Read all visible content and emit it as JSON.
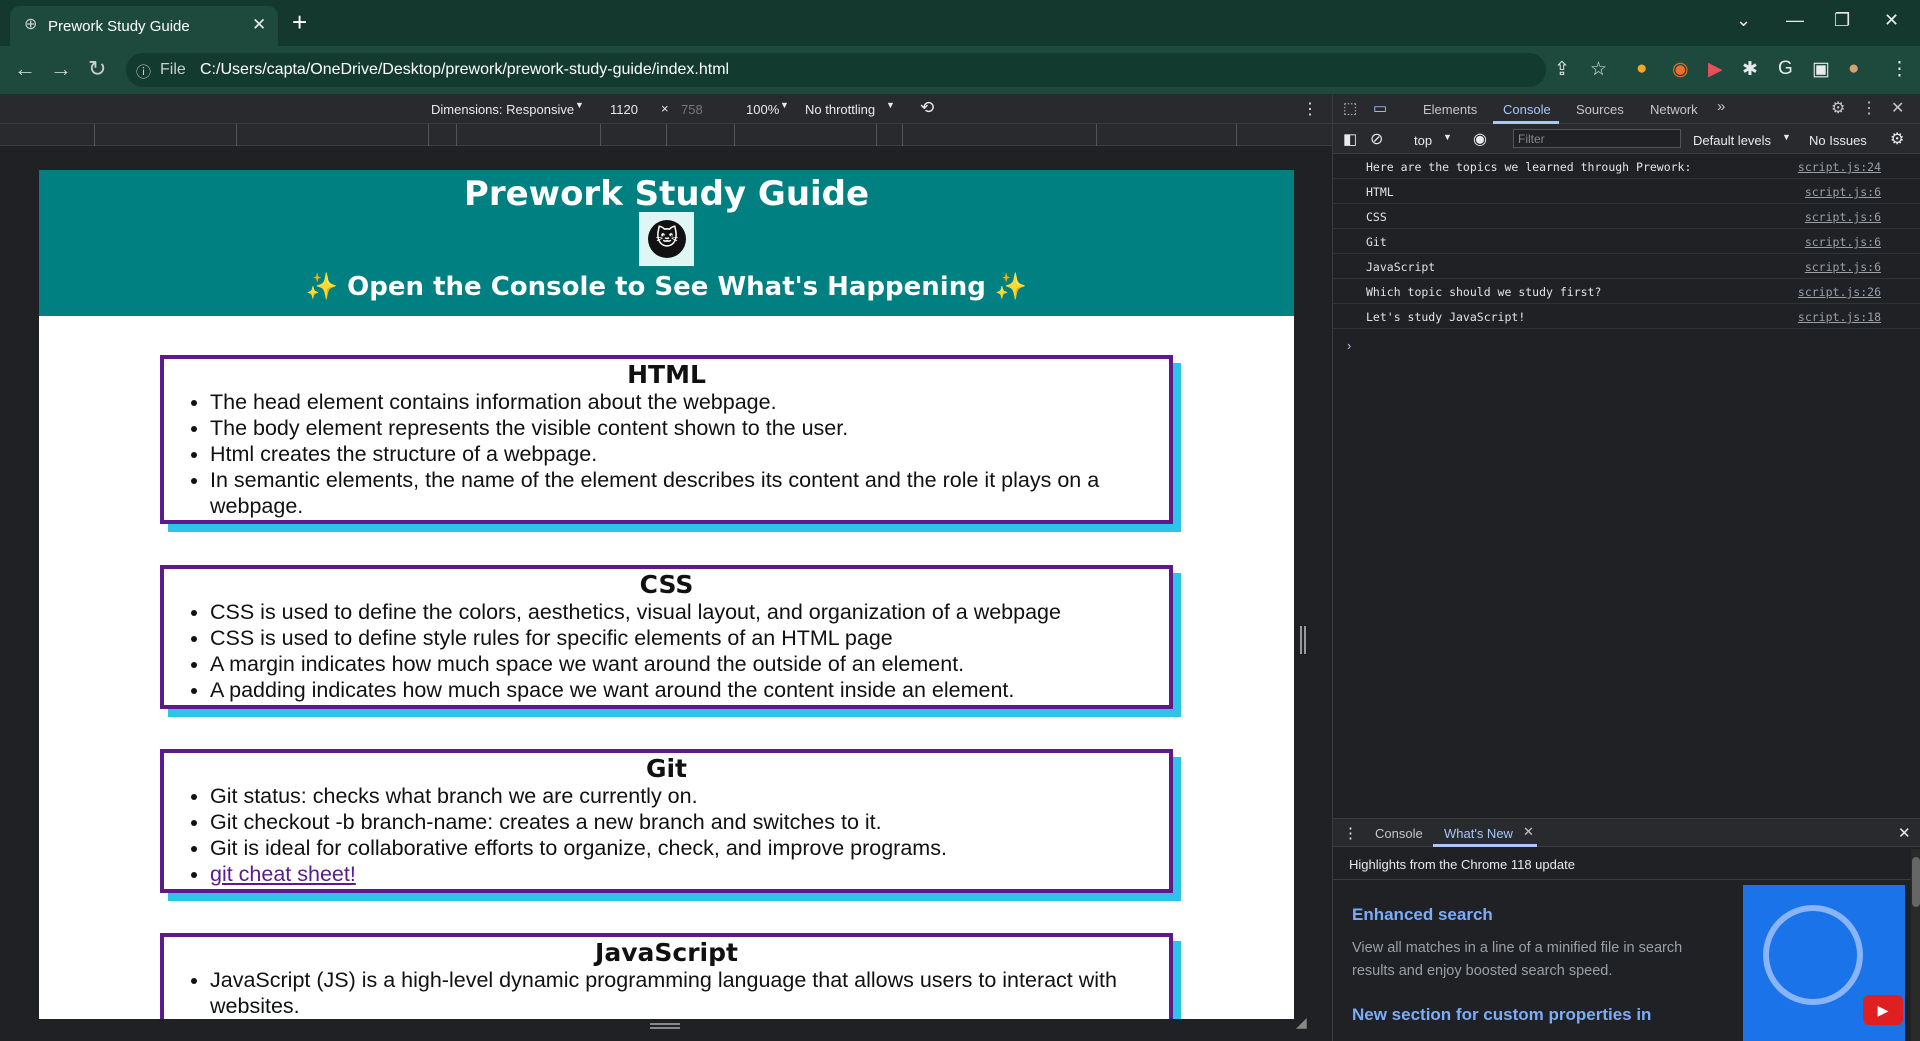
{
  "browser": {
    "tab_title": "Prework Study Guide",
    "url_scheme": "File",
    "url": "C:/Users/capta/OneDrive/Desktop/prework/prework-study-guide/index.html"
  },
  "device_toolbar": {
    "dimensions": "Dimensions: Responsive",
    "width": "1120",
    "times": "×",
    "height": "758",
    "zoom": "100%",
    "throttling": "No throttling"
  },
  "page": {
    "title": "Prework Study Guide",
    "subtitle": "✨ Open the Console to See What's Happening ✨",
    "sections": [
      {
        "heading": "HTML",
        "items": [
          "The head element contains information about the webpage.",
          "The body element represents the visible content shown to the user.",
          "Html creates the structure of a webpage.",
          "In semantic elements, the name of the element describes its content and the role it plays on a webpage."
        ]
      },
      {
        "heading": "CSS",
        "items": [
          "CSS is used to define the colors, aesthetics, visual layout, and organization of a webpage",
          "CSS is used to define style rules for specific elements of an HTML page",
          "A margin indicates how much space we want around the outside of an element.",
          "A padding indicates how much space we want around the content inside an element."
        ]
      },
      {
        "heading": "Git",
        "items": [
          "Git status: checks what branch we are currently on.",
          "Git checkout -b branch-name: creates a new branch and switches to it.",
          "Git is ideal for collaborative efforts to organize, check, and improve programs."
        ],
        "link": "git cheat sheet!"
      },
      {
        "heading": "JavaScript",
        "items": [
          "JavaScript (JS) is a high-level dynamic programming language that allows users to interact with websites."
        ]
      }
    ]
  },
  "devtools": {
    "tabs": [
      "Elements",
      "Console",
      "Sources",
      "Network"
    ],
    "context": "top",
    "filter_placeholder": "Filter",
    "levels": "Default levels",
    "issues": "No Issues",
    "logs": [
      {
        "msg": "Here are the topics we learned through Prework:",
        "src": "script.js:24"
      },
      {
        "msg": "HTML",
        "src": "script.js:6"
      },
      {
        "msg": "CSS",
        "src": "script.js:6"
      },
      {
        "msg": "Git",
        "src": "script.js:6"
      },
      {
        "msg": "JavaScript",
        "src": "script.js:6"
      },
      {
        "msg": "Which topic should we study first?",
        "src": "script.js:26"
      },
      {
        "msg": "Let's study JavaScript!",
        "src": "script.js:18"
      }
    ],
    "drawer": {
      "tabs": [
        "Console",
        "What's New"
      ],
      "highlights": "Highlights from the Chrome 118 update",
      "heading1": "Enhanced search",
      "body1": "View all matches in a line of a minified file in search results and enjoy boosted search speed.",
      "heading2": "New section for custom properties in"
    }
  },
  "colors": {
    "header": "#008080",
    "card_border": "#5c1a8c",
    "card_shadow": "#2ec4e8"
  }
}
